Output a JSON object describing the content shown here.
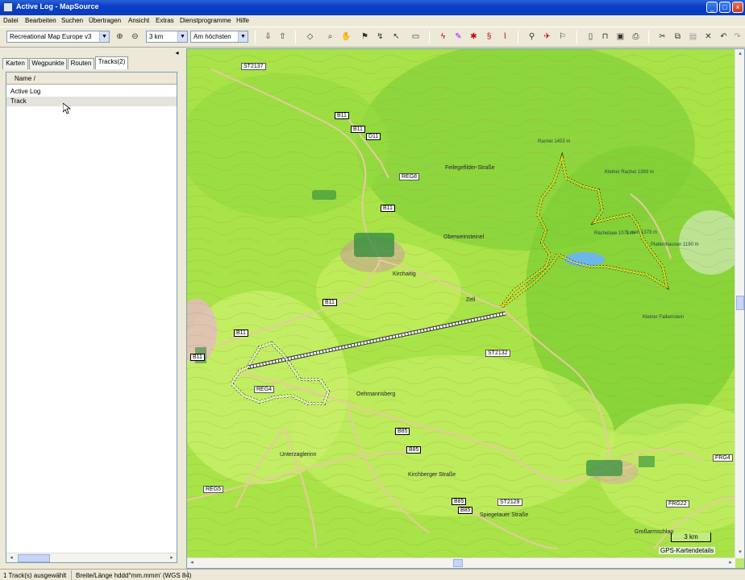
{
  "window": {
    "title": "Active Log - MapSource"
  },
  "menu": [
    "Datei",
    "Bearbeiten",
    "Suchen",
    "Übertragen",
    "Ansicht",
    "Extras",
    "Dienstprogramme",
    "Hilfe"
  ],
  "toolbar": {
    "map_product": "Recreational Map Europe v3",
    "zoom_value": "3 km",
    "detail_value": "Am höchsten"
  },
  "left_panel": {
    "tabs": [
      "Karten",
      "Wegpunkte",
      "Routen",
      "Tracks(2)"
    ],
    "active_tab": "Tracks(2)",
    "column_header": "Name  /",
    "tracks": [
      "Active Log",
      "Track"
    ],
    "selected_track": "Track"
  },
  "map": {
    "route_labels": [
      "ST2137",
      "B11",
      "B11",
      "B11",
      "D11",
      "REG8",
      "B11",
      "B11",
      "B11",
      "REG4",
      "ST2132",
      "B85",
      "B85",
      "B85",
      "B85",
      "ST2129",
      "FRG4",
      "FRG22",
      "REG5"
    ],
    "place_labels": [
      "Feilegefilder-Straße",
      "Oberweinsteinel",
      "Kirchaitig",
      "Zell",
      "Oehmannsberg",
      "Unterzaglerinn",
      "Kirchberger Straße",
      "Spiegelauer Straße",
      "Großarmschlag"
    ],
    "peak_labels": [
      "Rachel 1453 m",
      "Kleiner Rachel 1399 m",
      "Lusen 1373 m",
      "Kleiner Falkenstein",
      "Rachelsee 1071 m",
      "Plattenhausen 1190 m"
    ],
    "scale_label": "3 km",
    "attribution": "GPS-Kartendetails",
    "colors": {
      "forest": "#8ed83c",
      "meadow": "#c6ef60",
      "track_yellow": "#f4e10e",
      "track_white": "#ffffff",
      "road": "#e8c9a0",
      "contour": "#b39148"
    }
  },
  "status": {
    "selection": "1 Track(s) ausgewählt",
    "coord_format": "Breite/Länge hddd°mm.mmm' (WGS 84)"
  }
}
